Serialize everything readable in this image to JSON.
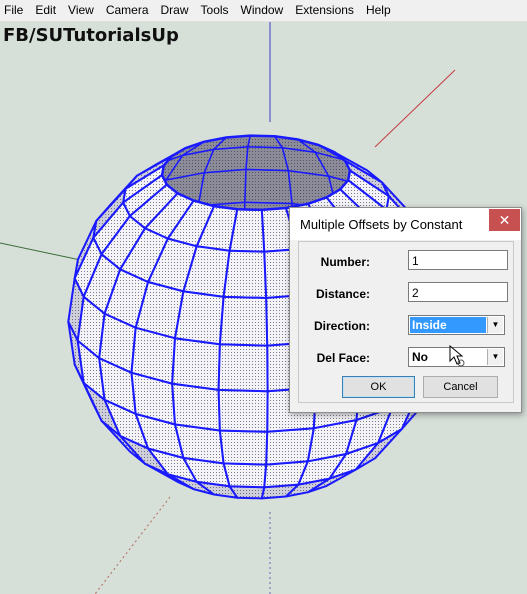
{
  "menu": [
    "File",
    "Edit",
    "View",
    "Camera",
    "Draw",
    "Tools",
    "Window",
    "Extensions",
    "Help"
  ],
  "watermark": "FB/SUTutorialsUp",
  "dialog": {
    "title": "Multiple Offsets by Constant",
    "close_symbol": "✕",
    "fields": {
      "number": {
        "label": "Number:",
        "value": "1"
      },
      "distance": {
        "label": "Distance:",
        "value": "2"
      },
      "direction": {
        "label": "Direction:",
        "value": "Inside"
      },
      "del_face": {
        "label": "Del Face:",
        "value": "No"
      }
    },
    "ok_label": "OK",
    "cancel_label": "Cancel"
  },
  "colors": {
    "sphere_edges": "#1a1aff",
    "viewport_bg": "#d7dfd9",
    "highlight": "#3399ff",
    "axis_red": "#c43c3c",
    "axis_green": "#3c8c3c",
    "axis_blue": "#3c3cc4"
  },
  "icons": {
    "cursor": "arrow-busy-cursor-icon",
    "dropdown": "chevron-down-icon"
  }
}
